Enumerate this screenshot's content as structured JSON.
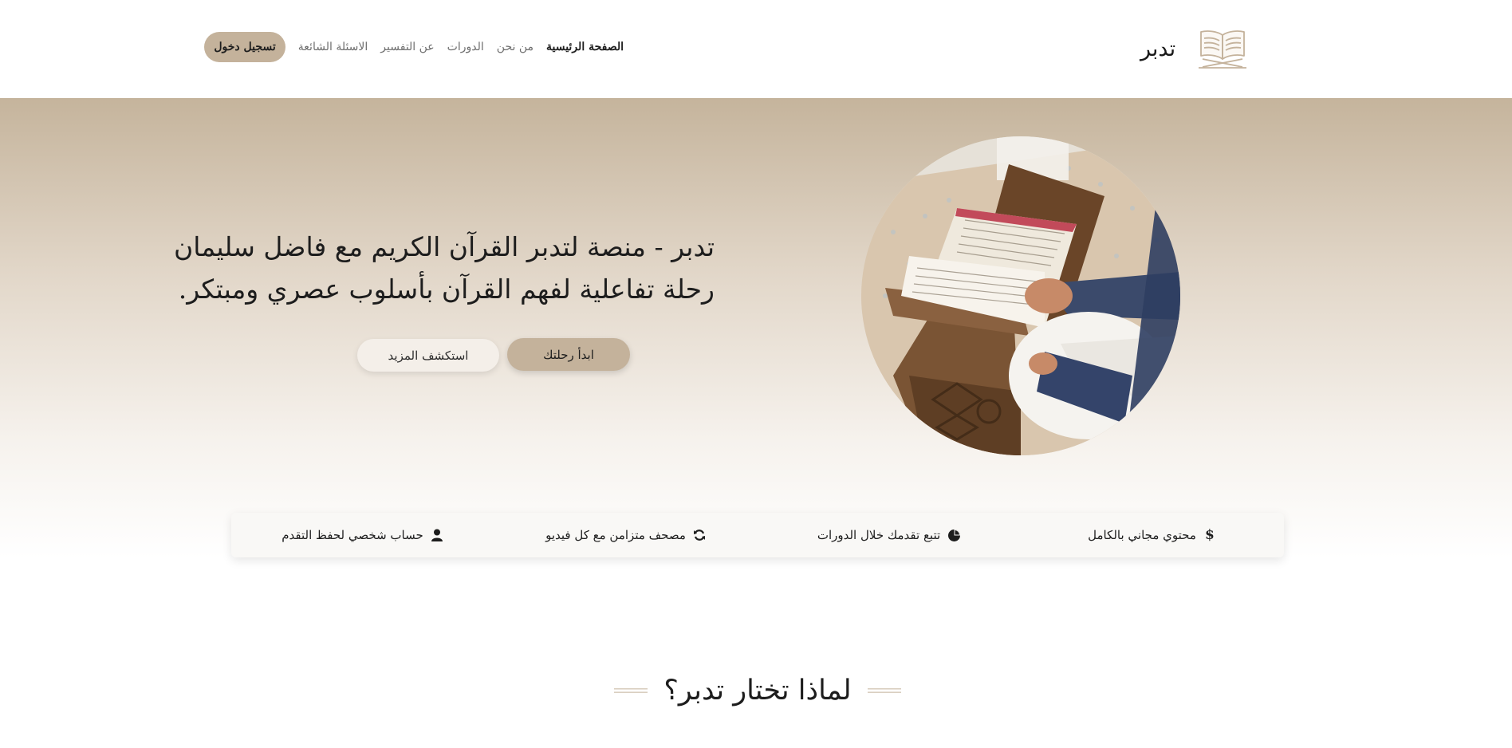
{
  "header": {
    "brand": "تدبر",
    "logo_icon": "open-book-on-stand-icon",
    "nav": {
      "login_label": "تسجيل دخول",
      "links": [
        "الصفحة الرئيسية",
        "من نحن",
        "الدورات",
        "عن التفسير",
        "الاسئلة الشائعة"
      ]
    }
  },
  "hero": {
    "title_line1": "تدبر - منصة لتدبر القرآن الكريم مع فاضل سليمان",
    "title_line2": "رحلة تفاعلية لفهم القرآن بأسلوب عصري ومبتكر.",
    "primary_button": "ابدأ رحلتك",
    "secondary_button": "استكشف المزيد",
    "image_icon": "quran-reading-photo"
  },
  "features": [
    {
      "label": "محتوي مجاني بالكامل",
      "icon": "dollar-icon"
    },
    {
      "label": "تتبع تقدمك خلال الدورات",
      "icon": "pie-chart-icon"
    },
    {
      "label": "مصحف متزامن مع كل فيديو",
      "icon": "sync-icon"
    },
    {
      "label": "حساب شخصي لحفظ التقدم",
      "icon": "user-icon"
    }
  ],
  "section": {
    "why_title": "لماذا تختار تدبر؟"
  },
  "colors": {
    "accent": "#c4b29b",
    "hero_top": "#c5b49c",
    "text": "#1d1d1d"
  }
}
